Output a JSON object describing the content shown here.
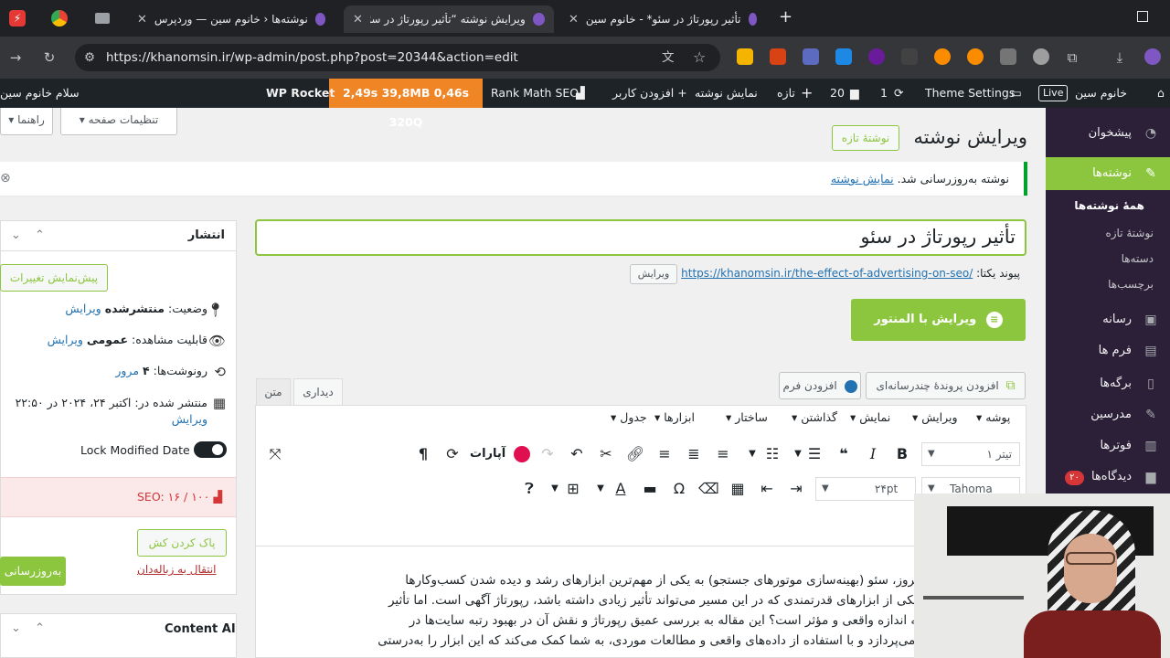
{
  "browser": {
    "tabs": [
      {
        "title": "نوشته‌ها ‹ خانوم سین — وردپرس",
        "active": false
      },
      {
        "title": "ویرایش نوشته “تأثیر رپورتاژ در سئو”",
        "active": true
      },
      {
        "title": "تأثیر رپورتاژ در سئو* - خانوم سین",
        "active": false
      }
    ],
    "new_tab": "+",
    "url": "https://khanomsin.ir/wp-admin/post.php?post=20344&action=edit"
  },
  "adminbar": {
    "site": "خانوم سین",
    "live": "Live",
    "theme_settings": "Theme Settings",
    "updates": "1",
    "comments": "20",
    "new": "تازه",
    "view_post": "نمایش نوشته",
    "add_user": "+ افزودن کاربر",
    "rankmath": "Rank Math SEO",
    "stats": "2,49s  39,8MB  0,46s  320Q",
    "wp_rocket": "WP Rocket",
    "greeting": "سلام خانوم سین"
  },
  "sidebar": {
    "items": [
      {
        "label": "پیشخوان",
        "icon": "dashboard-icon"
      },
      {
        "label": "نوشته‌ها",
        "icon": "pin-icon"
      },
      {
        "label": "همهٔ نوشته‌ها"
      },
      {
        "label": "نوشتهٔ تازه"
      },
      {
        "label": "دسته‌ها"
      },
      {
        "label": "برچسب‌ها"
      },
      {
        "label": "رسانه",
        "icon": "media-icon"
      },
      {
        "label": "فرم ها",
        "icon": "form-icon"
      },
      {
        "label": "برگه‌ها",
        "icon": "page-icon"
      },
      {
        "label": "مدرسین",
        "icon": "teacher-icon"
      },
      {
        "label": "فوترها",
        "icon": "footer-icon"
      },
      {
        "label": "دیدگاه‌ها",
        "icon": "comment-icon",
        "badge": "۲۰"
      }
    ]
  },
  "header": {
    "page_settings": "تنظیمات صفحه ▾",
    "help": "راهنما ▾",
    "title": "ویرایش نوشته",
    "add_new": "نوشتهٔ تازه"
  },
  "notice": {
    "text": "نوشته به‌روزرسانی شد.",
    "link": "نمایش نوشته"
  },
  "editor": {
    "post_title": "تأثیر رپورتاژ در سئو",
    "permalink_label": "پیوند یکتا:",
    "permalink_url": "https://khanomsin.ir/the-effect-of-advertising-on-seo/",
    "permalink_edit": "ویرایش",
    "elementor_button": "ویرایش با المنتور",
    "add_media": "افزودن پروندهٔ چندرسانه‌ای",
    "add_form": "افزودن فرم",
    "tab_visual": "دیداری",
    "tab_text": "متن",
    "menubar": [
      "پوشه ▾",
      "ویرایش ▾",
      "نمایش ▾",
      "گذاشتن ▾",
      "ساختار ▾",
      "ابزارها ▾",
      "جدول ▾"
    ],
    "paragraph_select": "تیتر ۱",
    "font_family": "Tahoma",
    "font_size": "۲۴pt",
    "aparat": "آپارات",
    "content_lines": [
      "امروز، سئو (بهینه‌سازی موتورهای جستجو) به یکی از مهم‌ترین ابزارهای رشد و دیده شدن کسب‌وکارها",
      ". یکی از ابزارهای قدرتمندی که در این مسیر می‌تواند تأثیر زیادی داشته باشد، رپورتاژ آگهی است. اما تأثیر",
      "چه اندازه واقعی و مؤثر است؟ این مقاله به بررسی عمیق رپورتاژ و نقش آن در بهبود رتبه سایت‌ها در",
      "و می‌پردازد و با استفاده از داده‌های واقعی و مطالعات موردی، به شما کمک می‌کند که این ابزار را به‌درستی"
    ]
  },
  "publish": {
    "title": "انتشار",
    "preview": "پیش‌نمایش تغییرات",
    "status_label": "وضعیت:",
    "status_value": "منتشرشده",
    "visibility_label": "قابلیت مشاهده:",
    "visibility_value": "عمومی",
    "revisions_label": "رونوشت‌ها:",
    "revisions_value": "۴",
    "revisions_link": "مرور",
    "published_label": "منتشر شده در: اکتبر ۲۴، ۲۰۲۴ در ۲۲:۵۰",
    "edit": "ویرایش",
    "lock_modified": "Lock Modified Date",
    "seo_score": "SEO: ۱۶ / ۱۰۰",
    "purge_cache": "پاک کردن کش",
    "trash": "انتقال به زباله‌دان",
    "update": "به‌روزرسانی",
    "content_ai": "Content AI"
  },
  "colors": {
    "sidebar_bg": "#2c2039",
    "adminbar_bg": "#1d2327",
    "accent_green": "#8cc63f",
    "rocket_orange": "#f08526",
    "link_blue": "#2271b1"
  }
}
